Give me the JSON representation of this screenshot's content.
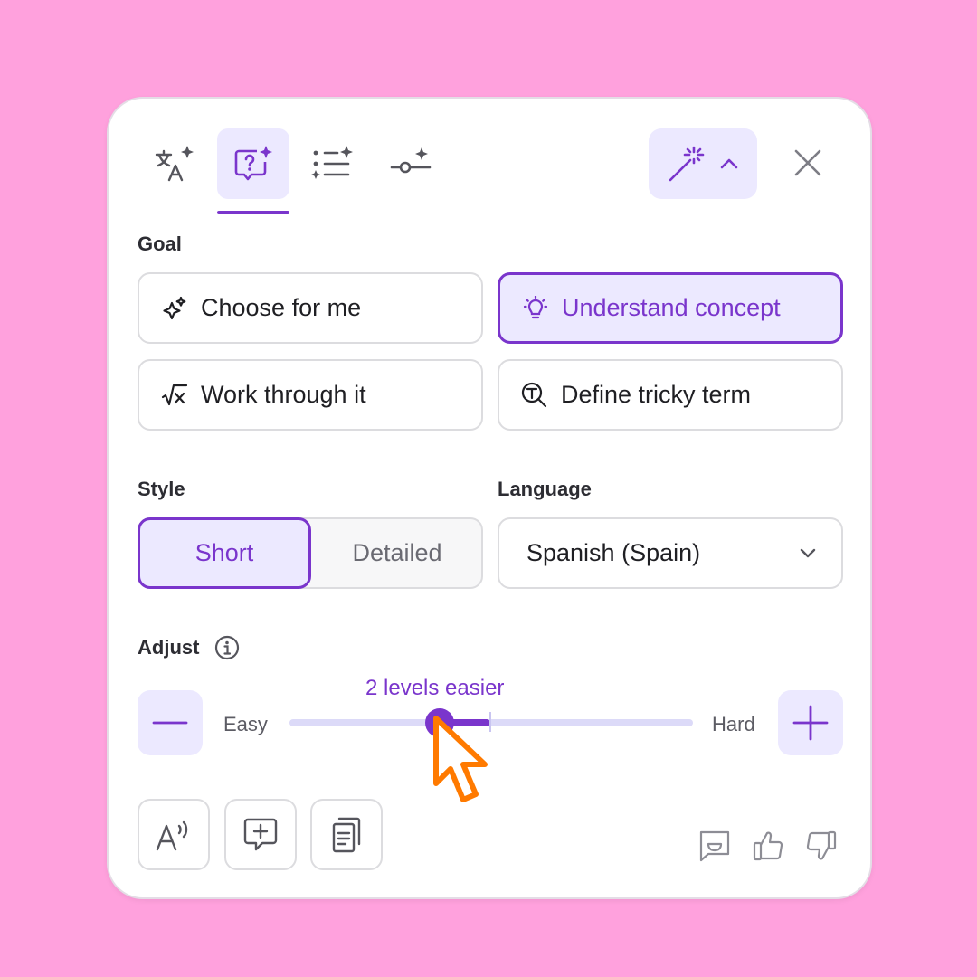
{
  "toolbar": {
    "tabs": [
      {
        "icon": "translate-sparkle-icon"
      },
      {
        "icon": "question-sparkle-icon",
        "active": true
      },
      {
        "icon": "list-sparkle-icon"
      },
      {
        "icon": "slider-sparkle-icon"
      }
    ],
    "magic_icon": "magic-wand-icon",
    "close_icon": "close-icon"
  },
  "goal": {
    "label": "Goal",
    "options": [
      {
        "label": "Choose for me",
        "icon": "sparkles-icon",
        "selected": false
      },
      {
        "label": "Understand concept",
        "icon": "lightbulb-icon",
        "selected": true
      },
      {
        "label": "Work through it",
        "icon": "square-root-icon",
        "selected": false
      },
      {
        "label": "Define tricky term",
        "icon": "magnify-term-icon",
        "selected": false
      }
    ]
  },
  "style": {
    "label": "Style",
    "options": [
      "Short",
      "Detailed"
    ],
    "selected": "Short"
  },
  "language": {
    "label": "Language",
    "value": "Spanish (Spain)"
  },
  "adjust": {
    "label": "Adjust",
    "level_text": "2 levels easier",
    "min_label": "Easy",
    "max_label": "Hard"
  },
  "colors": {
    "accent": "#7a35cc",
    "accent_bg": "#ece9ff",
    "background": "#ffa1dd",
    "cursor": "#ff7a00"
  }
}
